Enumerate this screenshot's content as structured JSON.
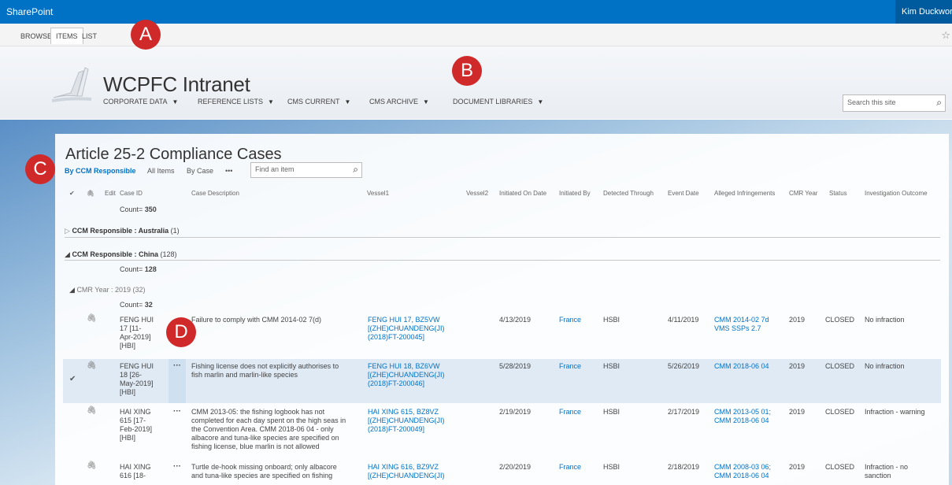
{
  "suite": {
    "brand": "SharePoint",
    "user": "Kim Duckworth"
  },
  "ribbon": {
    "tabs": [
      "BROWSE",
      "ITEMS",
      "LIST"
    ],
    "active": "ITEMS"
  },
  "site": {
    "title": "WCPFC Intranet",
    "nav": [
      "CORPORATE DATA",
      "REFERENCE LISTS",
      "CMS CURRENT",
      "CMS ARCHIVE",
      "DOCUMENT LIBRARIES"
    ],
    "search_placeholder": "Search this site"
  },
  "list": {
    "title": "Article 25-2 Compliance Cases",
    "views": {
      "selected": "By CCM Responsible",
      "others": [
        "All Items",
        "By Case",
        "•••"
      ]
    },
    "find_placeholder": "Find an item",
    "columns": [
      "Edit",
      "Case ID",
      "Case Description",
      "Vessel1",
      "Vessel2",
      "Initiated On Date",
      "Initiated By",
      "Detected Through",
      "Event Date",
      "Alleged Infringements",
      "CMR Year",
      "Status",
      "Investigation Outcome"
    ],
    "total_count": {
      "label": "Count=",
      "value": "350"
    },
    "groups": [
      {
        "label": "CCM Responsible",
        "value": "Australia",
        "count": "(1)"
      },
      {
        "label": "CCM Responsible",
        "value": "China",
        "count": "(128)",
        "count_label": "Count=",
        "count_value": "128"
      }
    ],
    "subgroup": {
      "label": "CMR Year",
      "value": "2019",
      "count": "(32)",
      "count_label": "Count=",
      "count_value": "32"
    },
    "rows": [
      {
        "case_id": [
          "FENG HUI",
          "17 [11-",
          "Apr-2019]",
          "[HBI]"
        ],
        "description": [
          "Failure to comply with CMM 2014-02 7(d)"
        ],
        "vessel1": [
          "FENG HUI 17, BZ5VW",
          "[(ZHE)CHUANDENG(JI)",
          "(2018)FT-200045]"
        ],
        "initiated_on": "4/13/2019",
        "initiated_by": "France",
        "detected": "HSBI",
        "event_date": "4/11/2019",
        "infringements": [
          "CMM 2014-02 7d",
          "VMS SSPs 2.7"
        ],
        "cmr_year": "2019",
        "status": "CLOSED",
        "outcome": [
          "No infraction"
        ]
      },
      {
        "case_id": [
          "FENG HUI",
          "18 [26-",
          "May-2019]",
          "[HBI]"
        ],
        "description": [
          "Fishing license does not explicitly authorises to",
          "fish marlin and marlin-like species"
        ],
        "vessel1": [
          "FENG HUI 18, BZ6VW",
          "[(ZHE)CHUANDENG(JI)",
          "(2018)FT-200046]"
        ],
        "initiated_on": "5/28/2019",
        "initiated_by": "France",
        "detected": "HSBI",
        "event_date": "5/26/2019",
        "infringements": [
          "CMM 2018-06 04"
        ],
        "cmr_year": "2019",
        "status": "CLOSED",
        "outcome": [
          "No infraction"
        ]
      },
      {
        "case_id": [
          "HAI XING",
          "615 [17-",
          "Feb-2019]",
          "[HBI]"
        ],
        "description": [
          "CMM 2013-05: the fishing logbook has not",
          "completed for each day spent on the high seas in",
          "the Convention Area.  CMM 2018-06 04 - only",
          "albacore and tuna-like species are specified on",
          "fishing license, blue marlin is not allowed"
        ],
        "vessel1": [
          "HAI XING 615, BZ8VZ",
          "[(ZHE)CHUANDENG(JI)",
          "(2018)FT-200049]"
        ],
        "initiated_on": "2/19/2019",
        "initiated_by": "France",
        "detected": "HSBI",
        "event_date": "2/17/2019",
        "infringements": [
          "CMM 2013-05 01;",
          "CMM 2018-06 04"
        ],
        "cmr_year": "2019",
        "status": "CLOSED",
        "outcome": [
          "Infraction - warning"
        ]
      },
      {
        "case_id": [
          "HAI XING",
          "616 [18-"
        ],
        "description": [
          "Turtle de-hook missing onboard; only albacore",
          "and tuna-like species are specified on fishing"
        ],
        "vessel1": [
          "HAI XING 616, BZ9VZ",
          "[(ZHE)CHUANDENG(JI)"
        ],
        "initiated_on": "2/20/2019",
        "initiated_by": "France",
        "detected": "HSBI",
        "event_date": "2/18/2019",
        "infringements": [
          "CMM 2008-03 06;",
          "CMM 2018-06 04"
        ],
        "cmr_year": "2019",
        "status": "CLOSED",
        "outcome": [
          "Infraction - no",
          "sanction"
        ]
      }
    ]
  },
  "markers": [
    "A",
    "B",
    "C",
    "D"
  ]
}
